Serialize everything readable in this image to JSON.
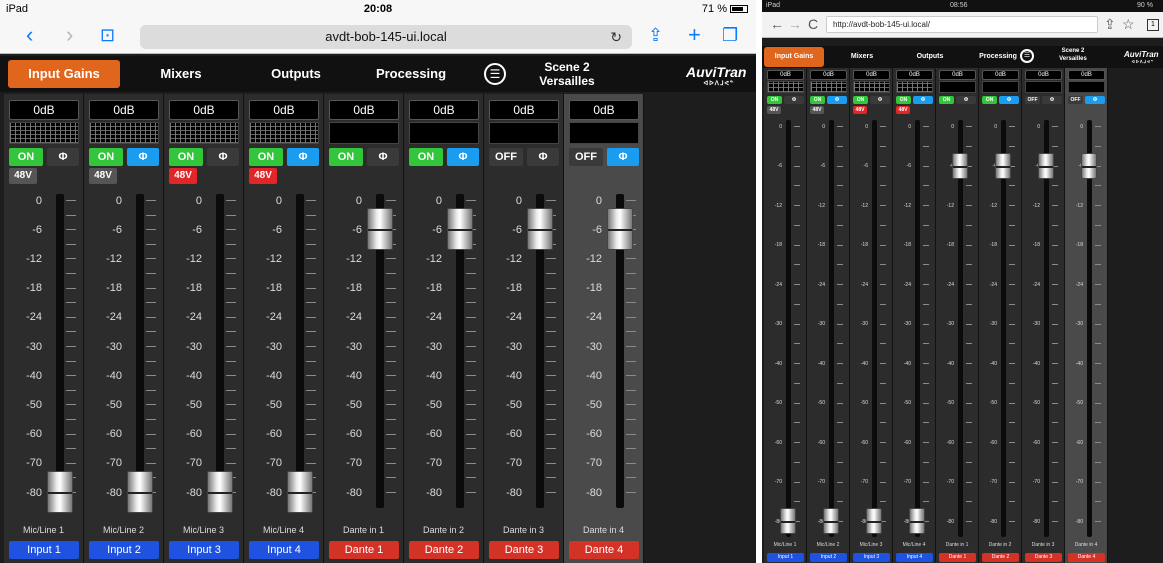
{
  "ipad_left": {
    "status": {
      "device": "iPad",
      "time": "20:08",
      "battery": "71 %"
    },
    "browser": {
      "url": "avdt-bob-145-ui.local",
      "reload_icon": "reload-icon",
      "back_icon": "back-chevron-icon",
      "forward_icon": "forward-chevron-icon",
      "bookmarks_icon": "bookmarks-icon",
      "share_icon": "share-icon",
      "add_icon": "plus-icon",
      "tabs_icon": "tabs-icon"
    }
  },
  "ipad_right": {
    "status": {
      "device": "iPad",
      "time": "08:56",
      "battery": "90 %"
    },
    "browser": {
      "url": "http://avdt-bob-145-ui.local/",
      "tab_count": "1"
    }
  },
  "app": {
    "tabs": [
      "Input Gains",
      "Mixers",
      "Outputs",
      "Processing"
    ],
    "active_tab": 0,
    "scene_line1": "Scene 2",
    "scene_line2": "Versailles",
    "logo": "AuviTran",
    "logo_sub": "ᐊᐅᐱᒧᕙᓐ",
    "accent_color": "#e0661d",
    "scale": [
      "0",
      "-6",
      "-12",
      "-18",
      "-24",
      "-30",
      "-40",
      "-50",
      "-60",
      "-70",
      "-80"
    ],
    "channels": [
      {
        "gain": "0dB",
        "state": "ON",
        "phase": false,
        "has48v": true,
        "p48": false,
        "p48_label": "48V",
        "fader_db": -80,
        "name": "Mic/Line 1",
        "label": "Input 1",
        "kind": "input",
        "meter_grid": true
      },
      {
        "gain": "0dB",
        "state": "ON",
        "phase": true,
        "has48v": true,
        "p48": false,
        "p48_label": "48V",
        "fader_db": -80,
        "name": "Mic/Line 2",
        "label": "Input 2",
        "kind": "input",
        "meter_grid": true
      },
      {
        "gain": "0dB",
        "state": "ON",
        "phase": false,
        "has48v": true,
        "p48": true,
        "p48_label": "48V",
        "fader_db": -80,
        "name": "Mic/Line 3",
        "label": "Input 3",
        "kind": "input",
        "meter_grid": true
      },
      {
        "gain": "0dB",
        "state": "ON",
        "phase": true,
        "has48v": true,
        "p48": true,
        "p48_label": "48V",
        "fader_db": -80,
        "name": "Mic/Line 4",
        "label": "Input 4",
        "kind": "input",
        "meter_grid": true
      },
      {
        "gain": "0dB",
        "state": "ON",
        "phase": false,
        "has48v": false,
        "fader_db": -6,
        "name": "Dante in 1",
        "label": "Dante 1",
        "kind": "dante",
        "meter_grid": false
      },
      {
        "gain": "0dB",
        "state": "ON",
        "phase": true,
        "has48v": false,
        "fader_db": -6,
        "name": "Dante in 2",
        "label": "Dante 2",
        "kind": "dante",
        "meter_grid": false
      },
      {
        "gain": "0dB",
        "state": "OFF",
        "phase": false,
        "has48v": false,
        "fader_db": -6,
        "name": "Dante in 3",
        "label": "Dante 3",
        "kind": "dante",
        "meter_grid": false
      },
      {
        "gain": "0dB",
        "state": "OFF",
        "phase": true,
        "has48v": false,
        "fader_db": -6,
        "name": "Dante in 4",
        "label": "Dante 4",
        "kind": "dante",
        "meter_grid": false,
        "selected": true
      }
    ],
    "phase_symbol": "Φ"
  }
}
